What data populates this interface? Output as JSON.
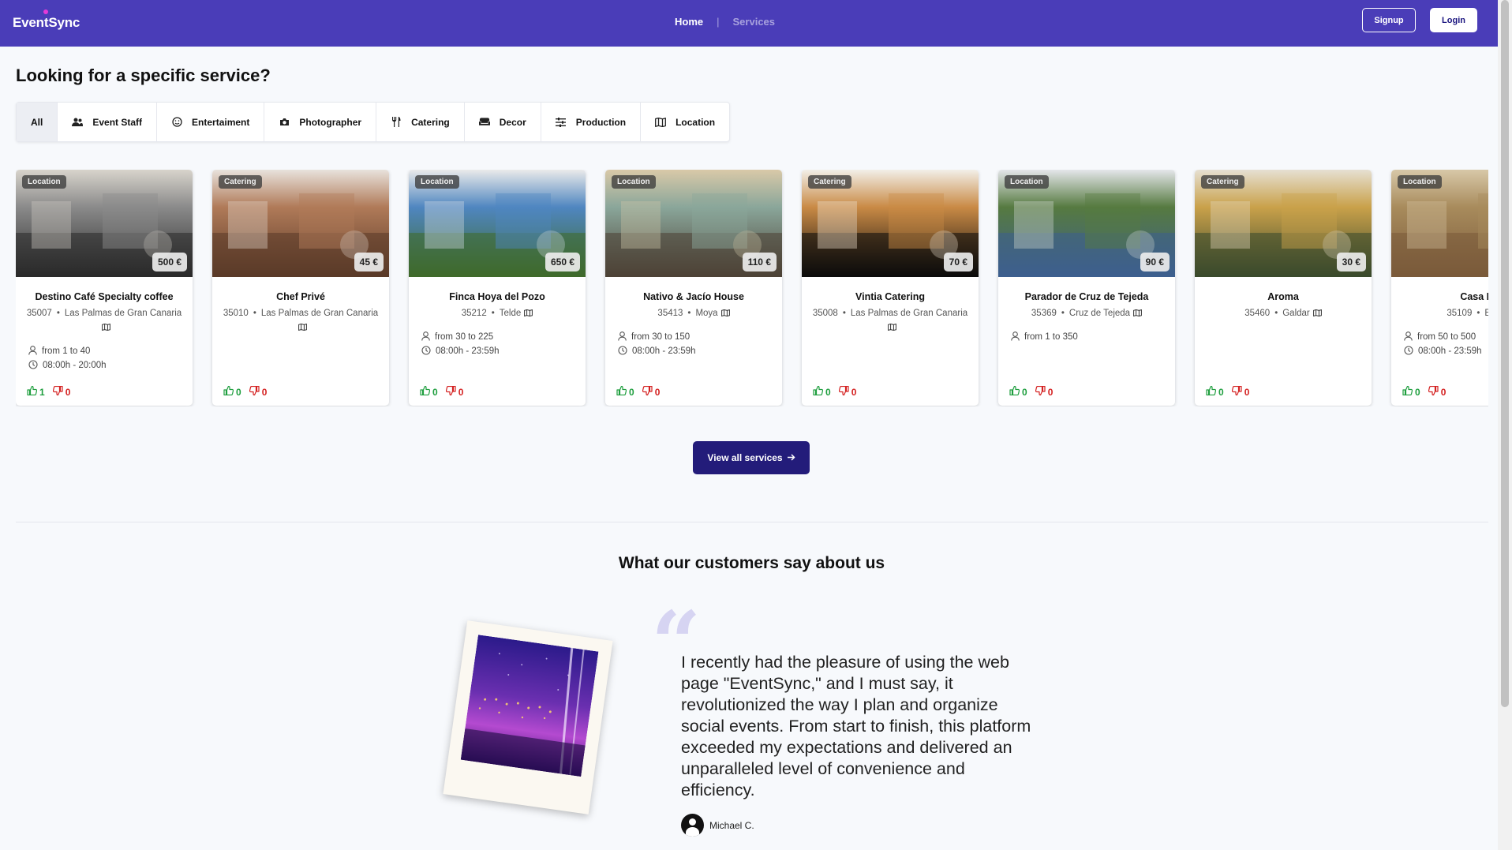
{
  "nav": {
    "logo": "EventSync",
    "links": [
      "Home",
      "Services"
    ],
    "signup_label": "Signup",
    "login_label": "Login"
  },
  "services_section": {
    "title": "Looking for a specific service?",
    "tabs": [
      {
        "label": "All",
        "icon": "none",
        "active": true
      },
      {
        "label": "Event Staff",
        "icon": "users-icon"
      },
      {
        "label": "Entertaiment",
        "icon": "smile-icon"
      },
      {
        "label": "Photographer",
        "icon": "camera-icon"
      },
      {
        "label": "Catering",
        "icon": "utensils-icon"
      },
      {
        "label": "Decor",
        "icon": "sofa-icon"
      },
      {
        "label": "Production",
        "icon": "sliders-icon"
      },
      {
        "label": "Location",
        "icon": "map-icon"
      }
    ]
  },
  "cards": [
    {
      "category": "Location",
      "price": "500 €",
      "name": "Destino Café Specialty coffee",
      "zip": "35007",
      "city": "Las Palmas de Gran Canaria",
      "capacity": "from 1 to 40",
      "hours": "08:00h - 20:00h",
      "likes": "1",
      "dislikes": "0",
      "palette": [
        "#2a2a2a",
        "#8a8a8a",
        "#d8d4cc"
      ]
    },
    {
      "category": "Catering",
      "price": "45 €",
      "name": "Chef Privé",
      "zip": "35010",
      "city": "Las Palmas de Gran Canaria",
      "capacity": "",
      "hours": "",
      "likes": "0",
      "dislikes": "0",
      "palette": [
        "#5a3a28",
        "#b07a58",
        "#e8e2dc"
      ]
    },
    {
      "category": "Location",
      "price": "650 €",
      "name": "Finca Hoya del Pozo",
      "zip": "35212",
      "city": "Telde",
      "capacity": "from 30 to 225",
      "hours": "08:00h - 23:59h",
      "likes": "0",
      "dislikes": "0",
      "palette": [
        "#3f6a2a",
        "#4f86c0",
        "#eaeaea"
      ]
    },
    {
      "category": "Location",
      "price": "110 €",
      "name": "Nativo & Jacío House",
      "zip": "35413",
      "city": "Moya",
      "capacity": "from 30 to 150",
      "hours": "08:00h - 23:59h",
      "likes": "0",
      "dislikes": "0",
      "palette": [
        "#4d4236",
        "#8aa69a",
        "#d9c9a8"
      ]
    },
    {
      "category": "Catering",
      "price": "70 €",
      "name": "Vintia Catering",
      "zip": "35008",
      "city": "Las Palmas de Gran Canaria",
      "capacity": "",
      "hours": "",
      "likes": "0",
      "dislikes": "0",
      "palette": [
        "#0b0b0b",
        "#c98a45",
        "#f2efe8"
      ]
    },
    {
      "category": "Location",
      "price": "90 €",
      "name": "Parador de Cruz de Tejeda",
      "zip": "35369",
      "city": "Cruz de Tejeda",
      "capacity": "from 1 to 350",
      "hours": "",
      "likes": "0",
      "dislikes": "0",
      "palette": [
        "#3d5f8f",
        "#567a40",
        "#e4e6ea"
      ]
    },
    {
      "category": "Catering",
      "price": "30 €",
      "name": "Aroma",
      "zip": "35460",
      "city": "Galdar",
      "capacity": "",
      "hours": "",
      "likes": "0",
      "dislikes": "0",
      "palette": [
        "#3a4a2c",
        "#c9a14a",
        "#e6e0d2"
      ]
    },
    {
      "category": "Location",
      "price": "",
      "name": "Casa Pu",
      "zip": "35109",
      "city": "El T",
      "capacity": "from 50 to 500",
      "hours": "08:00h - 23:59h",
      "likes": "0",
      "dislikes": "0",
      "palette": [
        "#7a5a3a",
        "#a88b5c",
        "#d8c8a8"
      ]
    }
  ],
  "view_all_label": "View all services",
  "testimonials": {
    "title": "What our customers say about us",
    "quote": "I recently had the pleasure of using the web page \"EventSync,\" and I must say, it revolutionized the way I plan and organize social events. From start to finish, this platform exceeded my expectations and delivered an unparalleled level of convenience and efficiency.",
    "author": "Michael C."
  }
}
